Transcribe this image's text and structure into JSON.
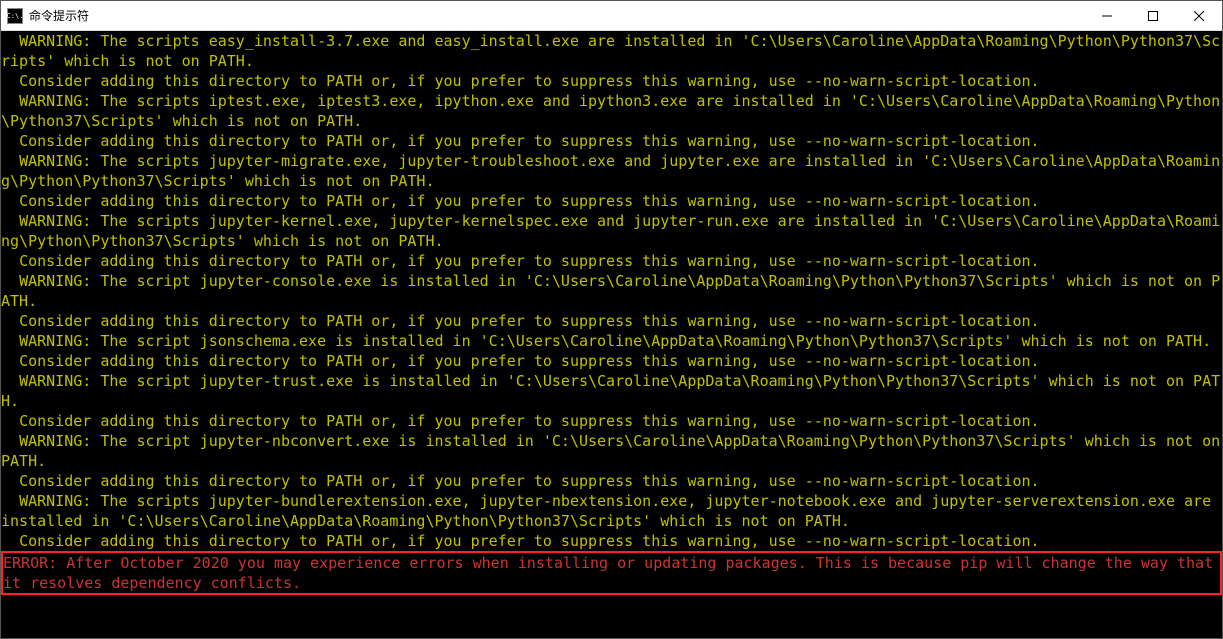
{
  "window": {
    "title": "命令提示符",
    "icon_text": "C:\\."
  },
  "lines": [
    {
      "cls": "warn",
      "text": "  WARNING: The scripts easy_install-3.7.exe and easy_install.exe are installed in 'C:\\Users\\Caroline\\AppData\\Roaming\\Python\\Python37\\Scripts' which is not on PATH."
    },
    {
      "cls": "warn",
      "text": "  Consider adding this directory to PATH or, if you prefer to suppress this warning, use --no-warn-script-location."
    },
    {
      "cls": "warn",
      "text": "  WARNING: The scripts iptest.exe, iptest3.exe, ipython.exe and ipython3.exe are installed in 'C:\\Users\\Caroline\\AppData\\Roaming\\Python\\Python37\\Scripts' which is not on PATH."
    },
    {
      "cls": "warn",
      "text": "  Consider adding this directory to PATH or, if you prefer to suppress this warning, use --no-warn-script-location."
    },
    {
      "cls": "warn",
      "text": "  WARNING: The scripts jupyter-migrate.exe, jupyter-troubleshoot.exe and jupyter.exe are installed in 'C:\\Users\\Caroline\\AppData\\Roaming\\Python\\Python37\\Scripts' which is not on PATH."
    },
    {
      "cls": "warn",
      "text": "  Consider adding this directory to PATH or, if you prefer to suppress this warning, use --no-warn-script-location."
    },
    {
      "cls": "warn",
      "text": "  WARNING: The scripts jupyter-kernel.exe, jupyter-kernelspec.exe and jupyter-run.exe are installed in 'C:\\Users\\Caroline\\AppData\\Roaming\\Python\\Python37\\Scripts' which is not on PATH."
    },
    {
      "cls": "warn",
      "text": "  Consider adding this directory to PATH or, if you prefer to suppress this warning, use --no-warn-script-location."
    },
    {
      "cls": "warn",
      "text": "  WARNING: The script jupyter-console.exe is installed in 'C:\\Users\\Caroline\\AppData\\Roaming\\Python\\Python37\\Scripts' which is not on PATH."
    },
    {
      "cls": "warn",
      "text": "  Consider adding this directory to PATH or, if you prefer to suppress this warning, use --no-warn-script-location."
    },
    {
      "cls": "warn",
      "text": "  WARNING: The script jsonschema.exe is installed in 'C:\\Users\\Caroline\\AppData\\Roaming\\Python\\Python37\\Scripts' which is not on PATH."
    },
    {
      "cls": "warn",
      "text": "  Consider adding this directory to PATH or, if you prefer to suppress this warning, use --no-warn-script-location."
    },
    {
      "cls": "warn",
      "text": "  WARNING: The script jupyter-trust.exe is installed in 'C:\\Users\\Caroline\\AppData\\Roaming\\Python\\Python37\\Scripts' which is not on PATH."
    },
    {
      "cls": "warn",
      "text": "  Consider adding this directory to PATH or, if you prefer to suppress this warning, use --no-warn-script-location."
    },
    {
      "cls": "warn",
      "text": "  WARNING: The script jupyter-nbconvert.exe is installed in 'C:\\Users\\Caroline\\AppData\\Roaming\\Python\\Python37\\Scripts' which is not on PATH."
    },
    {
      "cls": "warn",
      "text": "  Consider adding this directory to PATH or, if you prefer to suppress this warning, use --no-warn-script-location."
    },
    {
      "cls": "warn",
      "text": "  WARNING: The scripts jupyter-bundlerextension.exe, jupyter-nbextension.exe, jupyter-notebook.exe and jupyter-serverextension.exe are installed in 'C:\\Users\\Caroline\\AppData\\Roaming\\Python\\Python37\\Scripts' which is not on PATH."
    },
    {
      "cls": "warn",
      "text": "  Consider adding this directory to PATH or, if you prefer to suppress this warning, use --no-warn-script-location."
    }
  ],
  "error_block": {
    "text": "ERROR: After October 2020 you may experience errors when installing or updating packages. This is because pip will change the way that it resolves dependency conflicts."
  }
}
